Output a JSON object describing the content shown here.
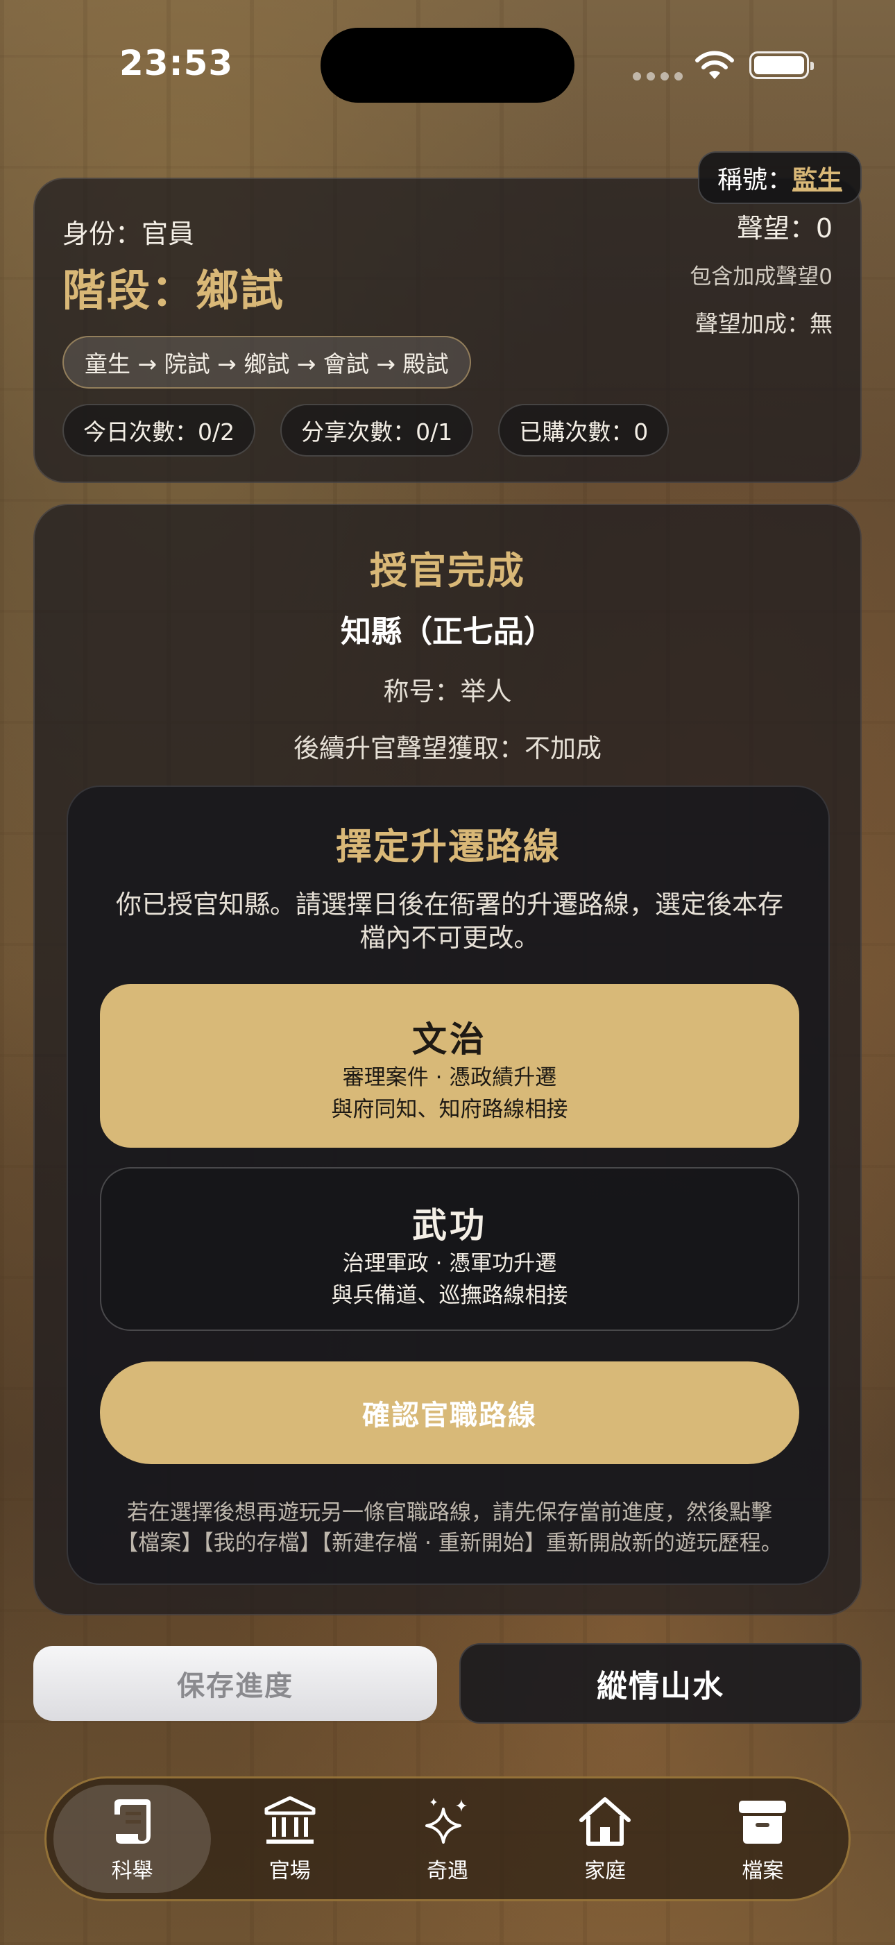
{
  "status_bar": {
    "time": "23:53"
  },
  "info": {
    "identity": "身份：官員",
    "stage": "階段：鄉試",
    "exam_path": "童生 → 院試 → 鄉試 → 會試 → 殿試",
    "counters": [
      "今日次數：0/2",
      "分享次數：0/1",
      "已購次數：0"
    ],
    "title_label": "稱號：",
    "title_value": "監生",
    "reputation": "聲望：0",
    "reputation_with_bonus": "包含加成聲望0",
    "reputation_bonus": "聲望加成：無"
  },
  "appointment": {
    "heading": "授官完成",
    "post": "知縣（正七品）",
    "rank_title": "称号：举人",
    "bonus_note": "後續升官聲望獲取：不加成"
  },
  "route": {
    "heading": "擇定升遷路線",
    "description": "你已授官知縣。請選擇日後在衙署的升遷路線，選定後本存檔內不可更改。",
    "options": [
      {
        "title": "文治",
        "line1": "審理案件 · 憑政績升遷",
        "line2": "與府同知、知府路線相接",
        "selected": true
      },
      {
        "title": "武功",
        "line1": "治理軍政 · 憑軍功升遷",
        "line2": "與兵備道、巡撫路線相接",
        "selected": false
      }
    ],
    "confirm_label": "確認官職路線",
    "footnote": "若在選擇後想再遊玩另一條官職路線，請先保存當前進度，然後點擊【檔案】【我的存檔】【新建存檔 · 重新開始】重新開啟新的遊玩歷程。"
  },
  "actions": {
    "save_label": "保存進度",
    "travel_label": "縱情山水"
  },
  "tabs": [
    {
      "label": "科舉",
      "icon": "scroll-icon",
      "active": true
    },
    {
      "label": "官場",
      "icon": "government-building-icon",
      "active": false
    },
    {
      "label": "奇遇",
      "icon": "sparkle-icon",
      "active": false
    },
    {
      "label": "家庭",
      "icon": "home-icon",
      "active": false
    },
    {
      "label": "檔案",
      "icon": "archive-box-icon",
      "active": false
    }
  ],
  "colors": {
    "accent_gold": "#d8b978",
    "card_bg": "#1c1a1e"
  }
}
